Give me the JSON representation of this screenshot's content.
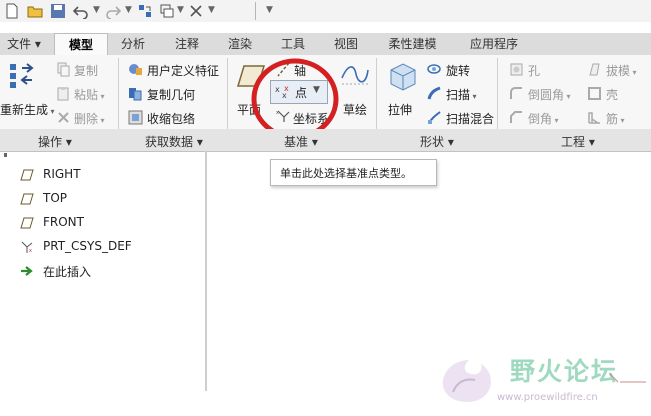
{
  "tabs": [
    "文件",
    "模型",
    "分析",
    "注释",
    "渲染",
    "工具",
    "视图",
    "柔性建模",
    "应用程序"
  ],
  "ops": {
    "regen": "重新生成",
    "copy": "复制",
    "paste": "粘贴",
    "delete": "删除"
  },
  "getdata": {
    "udf": "用户定义特征",
    "copygeom": "复制几何",
    "shrinkwrap": "收缩包络"
  },
  "datum": {
    "plane": "平面",
    "axis": "轴",
    "point": "点",
    "csys": "坐标系",
    "sketch": "草绘"
  },
  "shapes": {
    "extrude": "拉伸",
    "revolve": "旋转",
    "sweep": "扫描",
    "swept_blend": "扫描混合"
  },
  "engineering": {
    "hole": "孔",
    "draft": "拔模",
    "round": "倒圆角",
    "shell": "壳",
    "chamfer": "倒角",
    "rib": "筋"
  },
  "groups": {
    "ops": "操作",
    "getdata": "获取数据",
    "datum": "基准",
    "shapes": "形状",
    "engineering": "工程"
  },
  "tree": [
    "RIGHT",
    "TOP",
    "FRONT",
    "PRT_CSYS_DEF",
    "在此插入"
  ],
  "tooltip": "单击此处选择基准点类型。",
  "watermark": {
    "name": "野火论坛",
    "url": "www.proewildfire.cn"
  },
  "colors": {
    "annotation_circle": "#d42020",
    "active_tab_bg": "#fafafa",
    "tabbar_bg": "#dcdcdc",
    "insert_arrow": "#2e8b2e"
  }
}
